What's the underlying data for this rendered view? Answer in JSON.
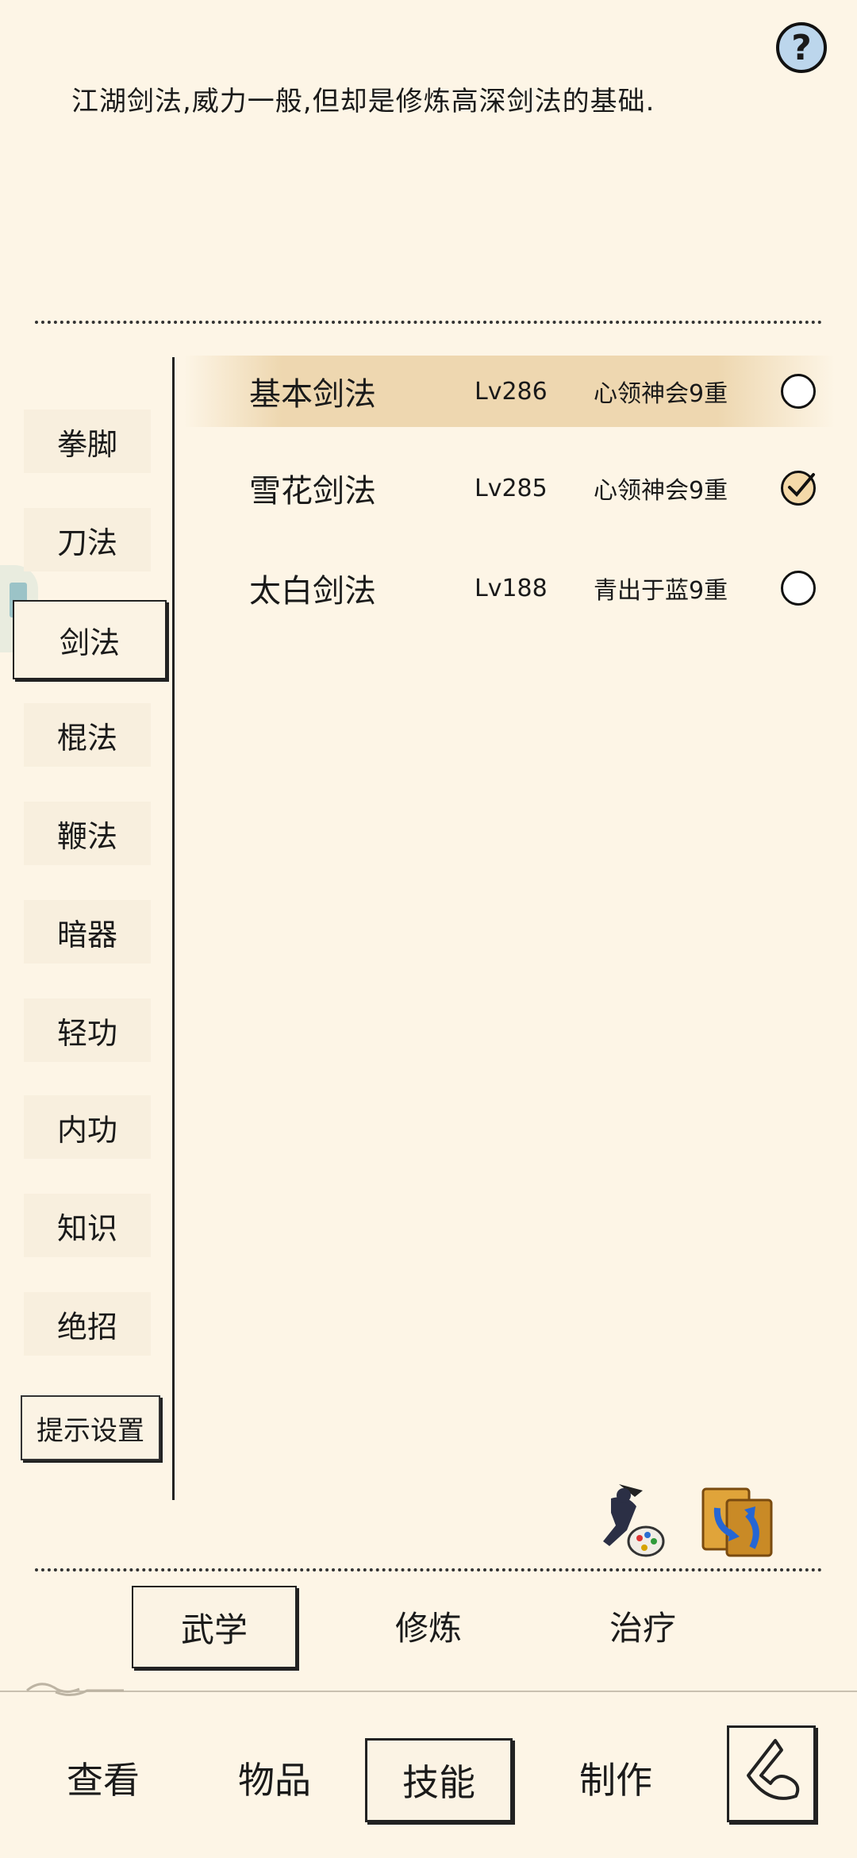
{
  "help": {
    "icon": "question-icon",
    "label": "?"
  },
  "description": "江湖剑法,威力一般,但却是修炼高深剑法的基础.",
  "categories": [
    "拳脚",
    "刀法",
    "剑法",
    "棍法",
    "鞭法",
    "暗器",
    "轻功",
    "内功",
    "知识",
    "绝招"
  ],
  "selected_category": "剑法",
  "hint_settings_label": "提示设置",
  "skills": [
    {
      "name": "基本剑法",
      "level": "Lv286",
      "rank": "心领神会9重",
      "checked": false,
      "highlighted": true
    },
    {
      "name": "雪花剑法",
      "level": "Lv285",
      "rank": "心领神会9重",
      "checked": true,
      "highlighted": false
    },
    {
      "name": "太白剑法",
      "level": "Lv188",
      "rank": "青出于蓝9重",
      "checked": false,
      "highlighted": false
    }
  ],
  "action_icons": [
    "swordsman-palette-icon",
    "book-swap-icon"
  ],
  "sub_tabs": [
    "武学",
    "修炼",
    "治疗"
  ],
  "selected_sub_tab": "武学",
  "nav": [
    "查看",
    "物品",
    "技能",
    "制作"
  ],
  "selected_nav": "技能",
  "back_icon": "back-arrow-icon"
}
